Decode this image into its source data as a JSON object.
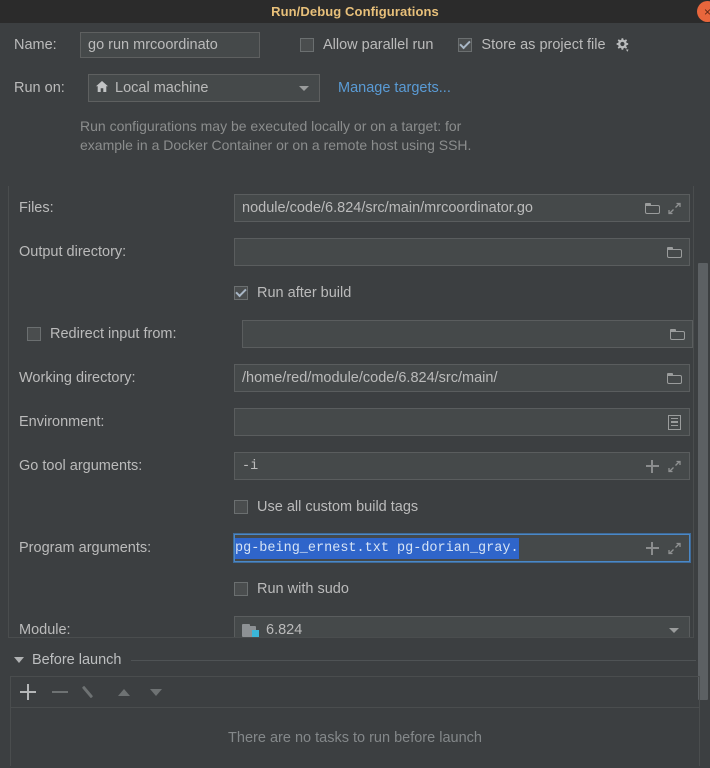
{
  "window": {
    "title": "Run/Debug Configurations",
    "close_icon": "close-icon",
    "close_glyph": "×"
  },
  "top": {
    "name_label": "Name:",
    "name_value": "go run mrcoordinato",
    "name_placeholder": "",
    "allow_parallel_label": "Allow parallel run",
    "allow_parallel_checked": false,
    "store_project_label": "Store as project file",
    "store_project_checked": true,
    "gear_icon": "gear-dropdown-icon",
    "run_on_label": "Run on:",
    "run_on_value": "Local machine",
    "run_on_icon": "home-icon",
    "manage_targets_link": "Manage targets...",
    "hint_line1": "Run configurations may be executed locally or on a target: for",
    "hint_line2": "example in a Docker Container or on a remote host using SSH."
  },
  "fields": {
    "files": {
      "label": "Files:",
      "value": "nodule/code/6.824/src/main/mrcoordinator.go",
      "folder_icon": "folder-icon",
      "expand_icon": "expand-icon"
    },
    "output_directory": {
      "label": "Output directory:",
      "value": "",
      "folder_icon": "folder-icon"
    },
    "run_after_build": {
      "label": "Run after build",
      "checked": true
    },
    "redirect_input": {
      "label": "Redirect input from:",
      "checked": false,
      "value": "",
      "folder_icon": "folder-icon"
    },
    "working_directory": {
      "label": "Working directory:",
      "value": "/home/red/module/code/6.824/src/main/",
      "folder_icon": "folder-icon"
    },
    "environment": {
      "label": "Environment:",
      "value": "",
      "list_icon": "environment-list-icon"
    },
    "go_tool_arguments": {
      "label": "Go tool arguments:",
      "value": "-i",
      "plus_icon": "plus-icon",
      "expand_icon": "expand-icon"
    },
    "use_custom_build_tags": {
      "label": "Use all custom build tags",
      "checked": false
    },
    "program_arguments": {
      "label": "Program arguments:",
      "value": "pg-being_ernest.txt pg-dorian_gray.",
      "selected": true,
      "plus_icon": "plus-icon",
      "expand_icon": "expand-icon"
    },
    "run_with_sudo": {
      "label": "Run with sudo",
      "checked": false
    },
    "module": {
      "label": "Module:",
      "value": "6.824",
      "folder_icon": "module-folder-icon"
    }
  },
  "before_launch": {
    "title": "Before launch",
    "collapse_icon": "triangle-down-icon",
    "toolbar": {
      "add_icon": "plus-icon",
      "remove_icon": "minus-icon",
      "edit_icon": "pencil-icon",
      "move_up_icon": "arrow-up-icon",
      "move_down_icon": "arrow-down-icon"
    },
    "empty_text": "There are no tasks to run before launch"
  },
  "colors": {
    "window_bg": "#3c3f41",
    "titlebar_bg": "#2b2b2b",
    "title_text": "#e8c07a",
    "field_bg": "#45494a",
    "accent_link": "#5a9bd5",
    "selection_blue": "#2f65ca",
    "close_orange": "#e8663c",
    "module_badge": "#3ab6d8"
  }
}
